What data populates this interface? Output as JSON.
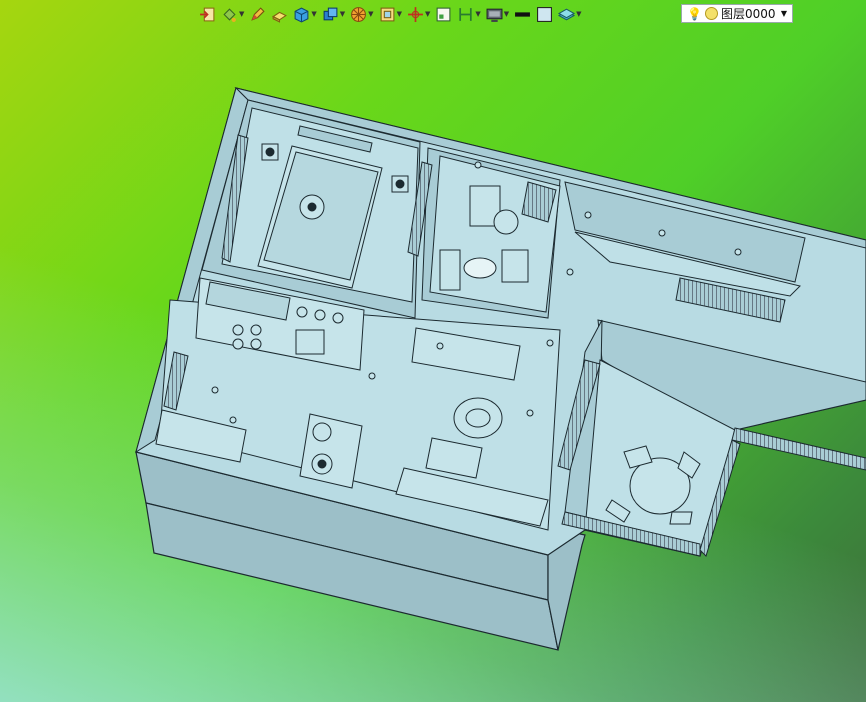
{
  "toolbar": {
    "buttons": [
      {
        "icon": "import-icon",
        "dropdown": false
      },
      {
        "icon": "paint-bucket-icon",
        "dropdown": true
      },
      {
        "icon": "pencil-icon",
        "dropdown": false
      },
      {
        "icon": "box-eraser-icon",
        "dropdown": false
      },
      {
        "icon": "cube-icon",
        "dropdown": true
      },
      {
        "icon": "cube-stack-icon",
        "dropdown": true
      },
      {
        "icon": "wheel-icon",
        "dropdown": true
      },
      {
        "icon": "frame-icon",
        "dropdown": true
      },
      {
        "icon": "axis-icon",
        "dropdown": true
      },
      {
        "icon": "view-icon",
        "dropdown": false
      },
      {
        "icon": "height-icon",
        "dropdown": true
      },
      {
        "icon": "monitor-icon",
        "dropdown": true
      },
      {
        "icon": "line-color-icon",
        "dropdown": false
      },
      {
        "icon": "fill-color-icon",
        "dropdown": false
      },
      {
        "icon": "layers-icon",
        "dropdown": true
      }
    ],
    "layer": {
      "name": "图层0000"
    }
  },
  "colors": {
    "accent": "#a8d2da",
    "wall": "#9ec2cc",
    "floor": "#bcdde5",
    "line": "#1c2a30"
  }
}
